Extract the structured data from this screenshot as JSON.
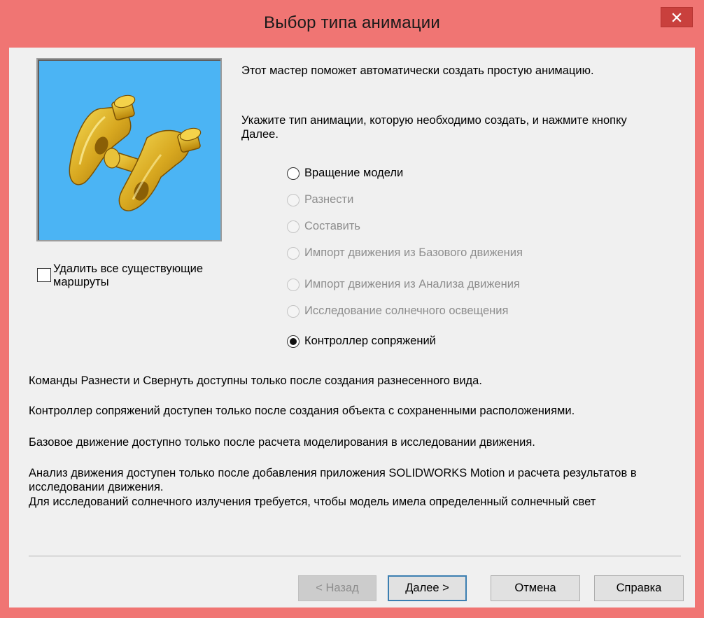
{
  "window": {
    "title": "Выбор типа анимации",
    "accent_color": "#f07573",
    "close_icon": "close-icon"
  },
  "preview": {
    "background_color": "#4bb4f4",
    "image": "yellow-mechanical-part-3d-model"
  },
  "checkbox": {
    "label": "Удалить все существующие маршруты",
    "checked": false
  },
  "intro": {
    "line1": "Этот мастер поможет автоматически создать простую анимацию.",
    "line2": "Укажите тип анимации, которую необходимо создать, и нажмите кнопку Далее."
  },
  "options": [
    {
      "label": "Вращение модели",
      "enabled": true,
      "checked": false
    },
    {
      "label": "Разнести",
      "enabled": false,
      "checked": false
    },
    {
      "label": "Составить",
      "enabled": false,
      "checked": false
    },
    {
      "label": "Импорт движения из Базового движения",
      "enabled": false,
      "checked": false
    },
    {
      "label": "Импорт движения из Анализа движения",
      "enabled": false,
      "checked": false
    },
    {
      "label": "Исследование солнечного освещения",
      "enabled": false,
      "checked": false
    },
    {
      "label": "Контроллер сопряжений",
      "enabled": true,
      "checked": true
    }
  ],
  "notes": [
    "Команды Разнести и Свернуть доступны только после создания разнесенного вида.",
    "Контроллер сопряжений доступен только после создания объекта с сохраненными расположениями.",
    "Базовое движение доступно только после расчета моделирования в исследовании движения.",
    "Анализ движения доступен только после добавления приложения SOLIDWORKS Motion и расчета результатов в исследовании движения.",
    "Для исследований солнечного излучения требуется, чтобы модель имела определенный солнечный свет"
  ],
  "buttons": {
    "back": "< Назад",
    "next": "Далее >",
    "cancel": "Отмена",
    "help": "Справка"
  }
}
